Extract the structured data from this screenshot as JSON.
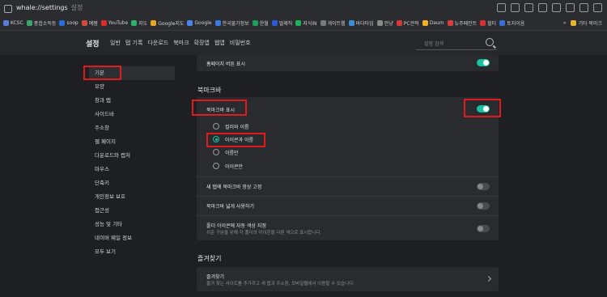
{
  "address_bar": {
    "url": "whale://settings",
    "page": "설정"
  },
  "bookmarks": {
    "items": [
      {
        "label": "KCSC",
        "color": "#5a7bd8"
      },
      {
        "label": "종합소득등",
        "color": "#3aa66a"
      },
      {
        "label": "soop",
        "color": "#2c6cdb"
      },
      {
        "label": "예쩜",
        "color": "#d44a3a"
      },
      {
        "label": "YouTube",
        "color": "#e02b2b"
      },
      {
        "label": "지도",
        "color": "#2db36b"
      },
      {
        "label": "Google지도",
        "color": "#e6a623"
      },
      {
        "label": "Google",
        "color": "#4a86f0"
      },
      {
        "label": "한국물가정보",
        "color": "#3a7ae0"
      },
      {
        "label": "한월",
        "color": "#1c9d5a"
      },
      {
        "label": "멀제직",
        "color": "#2a5bd7"
      },
      {
        "label": "지식iN",
        "color": "#19b55a"
      },
      {
        "label": "게이트웹",
        "color": "#7a7a7a"
      },
      {
        "label": "바다타임",
        "color": "#3a8fd8"
      },
      {
        "label": "안냥",
        "color": "#8a8a8a"
      },
      {
        "label": "PC견적",
        "color": "#d43a3a"
      },
      {
        "label": "Daum",
        "color": "#f0b020"
      },
      {
        "label": "뉴주페인트",
        "color": "#d84040"
      },
      {
        "label": "힐티",
        "color": "#d83030"
      },
      {
        "label": "토지이음",
        "color": "#3a6fd8"
      }
    ],
    "overflow": "»",
    "other": "기타 북마크"
  },
  "header": {
    "title": "설정",
    "tabs": [
      "일반",
      "탭 기록",
      "다운로드",
      "북마크",
      "확장앱",
      "웹앱",
      "비밀번호"
    ],
    "search_placeholder": "설정 검색"
  },
  "sidebar": {
    "items": [
      "기본",
      "모양",
      "창과 탭",
      "사이드바",
      "주소창",
      "웹 페이지",
      "다운로드와 캡처",
      "마우스",
      "단축키",
      "개인정보 보호",
      "접근성",
      "성능 및 기타",
      "네이버 웨일 정보",
      "모두 보기"
    ]
  },
  "content": {
    "top_row_label": "홈페이지 버튼 표시",
    "bookmark_bar": {
      "section": "북마크바",
      "show_label": "북마크바 표시",
      "radio_options": [
        "컬러와 이름",
        "아이콘과 이름",
        "이름만",
        "아이콘만"
      ],
      "selected": 1,
      "new_tab_label": "새 탭에 북마크바 항상 고정",
      "wide_label": "북마크바 넓게 사용하기",
      "auto_color_label": "폴더 아이콘에 자동 색상 지정",
      "auto_color_desc": "쉬운 구분을 위해 각 폴더의 아이콘을 다른 색으로 표시합니다."
    },
    "favorites": {
      "section": "즐겨찾기",
      "label": "즐겨찾기",
      "desc": "즐겨 찾는 사이트를 추가하고 새 탭과 주소창, 모바일웹에서 이용할 수 있습니다."
    }
  },
  "toggles": {
    "homepage": true,
    "show_bookmark_bar": true,
    "new_tab": false,
    "wide": false,
    "auto_color": false
  }
}
